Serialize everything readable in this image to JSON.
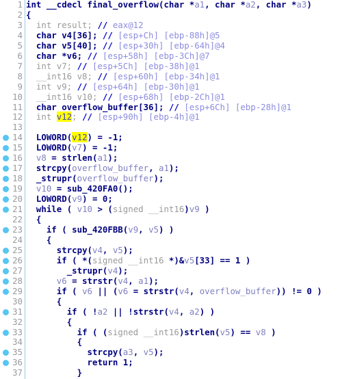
{
  "app": {
    "view": "pseudocode",
    "function_name": "final_overflow",
    "background": "#ffffff",
    "gutter_rule_color": "#9ec8e8",
    "marker_dot_color": "#56c6f2",
    "highlight_color": "#ffff00",
    "keyword_color": "#00007f",
    "comment_color": "#8c8ce0",
    "variable_color": "#8080c0",
    "linenumber_color": "#9a9a9a"
  },
  "highlighted_token": "v12",
  "lines": [
    {
      "n": "1",
      "dot": false,
      "indent": 0,
      "tokens": [
        {
          "t": "kw",
          "v": "int"
        },
        {
          "t": "plain",
          "v": " __cdecl "
        },
        {
          "t": "name",
          "v": "final_overflow"
        },
        {
          "t": "punc",
          "v": "("
        },
        {
          "t": "kw",
          "v": "char"
        },
        {
          "t": "plain",
          "v": " *"
        },
        {
          "t": "arg",
          "v": "a1"
        },
        {
          "t": "punc",
          "v": ", "
        },
        {
          "t": "kw",
          "v": "char"
        },
        {
          "t": "plain",
          "v": " *"
        },
        {
          "t": "arg",
          "v": "a2"
        },
        {
          "t": "punc",
          "v": ", "
        },
        {
          "t": "kw",
          "v": "char"
        },
        {
          "t": "plain",
          "v": " *"
        },
        {
          "t": "arg",
          "v": "a3"
        },
        {
          "t": "punc",
          "v": ")"
        }
      ]
    },
    {
      "n": "2",
      "dot": false,
      "indent": 0,
      "tokens": [
        {
          "t": "punc",
          "v": "{"
        }
      ]
    },
    {
      "n": "3",
      "dot": false,
      "indent": 1,
      "tokens": [
        {
          "t": "gray",
          "v": "int "
        },
        {
          "t": "gray",
          "v": "result"
        },
        {
          "t": "gray",
          "v": "; "
        },
        {
          "t": "cmt-slash",
          "v": "// "
        },
        {
          "t": "cmt",
          "v": "eax@12"
        }
      ]
    },
    {
      "n": "4",
      "dot": false,
      "indent": 1,
      "tokens": [
        {
          "t": "kw",
          "v": "char"
        },
        {
          "t": "plain",
          "v": " v4[36]; "
        },
        {
          "t": "cmt-slash",
          "v": "// "
        },
        {
          "t": "cmt",
          "v": "[esp+Ch] [ebp-88h]@5"
        }
      ]
    },
    {
      "n": "5",
      "dot": false,
      "indent": 1,
      "tokens": [
        {
          "t": "kw",
          "v": "char"
        },
        {
          "t": "plain",
          "v": " v5[40]; "
        },
        {
          "t": "cmt-slash",
          "v": "// "
        },
        {
          "t": "cmt",
          "v": "[esp+30h] [ebp-64h]@4"
        }
      ]
    },
    {
      "n": "6",
      "dot": false,
      "indent": 1,
      "tokens": [
        {
          "t": "kw",
          "v": "char"
        },
        {
          "t": "plain",
          "v": " *v6; "
        },
        {
          "t": "cmt-slash",
          "v": "// "
        },
        {
          "t": "cmt",
          "v": "[esp+58h] [ebp-3Ch]@7"
        }
      ]
    },
    {
      "n": "7",
      "dot": false,
      "indent": 1,
      "tokens": [
        {
          "t": "gray",
          "v": "int v7; "
        },
        {
          "t": "cmt-slash",
          "v": "// "
        },
        {
          "t": "cmt",
          "v": "[esp+5Ch] [ebp-38h]@1"
        }
      ]
    },
    {
      "n": "8",
      "dot": false,
      "indent": 1,
      "tokens": [
        {
          "t": "gray",
          "v": "__int16 v8; "
        },
        {
          "t": "cmt-slash",
          "v": "// "
        },
        {
          "t": "cmt",
          "v": "[esp+60h] [ebp-34h]@1"
        }
      ]
    },
    {
      "n": "9",
      "dot": false,
      "indent": 1,
      "tokens": [
        {
          "t": "gray",
          "v": "int v9; "
        },
        {
          "t": "cmt-slash",
          "v": "// "
        },
        {
          "t": "cmt",
          "v": "[esp+64h] [ebp-30h]@1"
        }
      ]
    },
    {
      "n": "10",
      "dot": false,
      "indent": 1,
      "tokens": [
        {
          "t": "gray",
          "v": "__int16 v10; "
        },
        {
          "t": "cmt-slash",
          "v": "// "
        },
        {
          "t": "cmt",
          "v": "[esp+68h] [ebp-2Ch]@1"
        }
      ]
    },
    {
      "n": "11",
      "dot": false,
      "indent": 1,
      "tokens": [
        {
          "t": "kw",
          "v": "char"
        },
        {
          "t": "plain",
          "v": " overflow_buffer[36]; "
        },
        {
          "t": "cmt-slash",
          "v": "// "
        },
        {
          "t": "cmt",
          "v": "[esp+6Ch] [ebp-28h]@1"
        }
      ]
    },
    {
      "n": "12",
      "dot": false,
      "indent": 1,
      "tokens": [
        {
          "t": "gray",
          "v": "int "
        },
        {
          "t": "hl",
          "v": "v12"
        },
        {
          "t": "gray",
          "v": "; "
        },
        {
          "t": "cmt-slash",
          "v": "// "
        },
        {
          "t": "cmt",
          "v": "[esp+90h] [ebp-4h]@1"
        }
      ]
    },
    {
      "n": "13",
      "dot": false,
      "indent": 0,
      "tokens": []
    },
    {
      "n": "14",
      "dot": true,
      "indent": 1,
      "tokens": [
        {
          "t": "fn",
          "v": "LOWORD"
        },
        {
          "t": "punc",
          "v": "("
        },
        {
          "t": "hl",
          "v": "v12"
        },
        {
          "t": "punc",
          "v": ") = -1;"
        }
      ]
    },
    {
      "n": "15",
      "dot": true,
      "indent": 1,
      "tokens": [
        {
          "t": "fn",
          "v": "LOWORD"
        },
        {
          "t": "punc",
          "v": "("
        },
        {
          "t": "var",
          "v": "v7"
        },
        {
          "t": "punc",
          "v": ") = -1;"
        }
      ]
    },
    {
      "n": "16",
      "dot": true,
      "indent": 1,
      "tokens": [
        {
          "t": "var",
          "v": "v8"
        },
        {
          "t": "punc",
          "v": " = "
        },
        {
          "t": "fn",
          "v": "strlen"
        },
        {
          "t": "punc",
          "v": "("
        },
        {
          "t": "arg",
          "v": "a1"
        },
        {
          "t": "punc",
          "v": ");"
        }
      ]
    },
    {
      "n": "17",
      "dot": true,
      "indent": 1,
      "tokens": [
        {
          "t": "fn",
          "v": "strcpy"
        },
        {
          "t": "punc",
          "v": "("
        },
        {
          "t": "var",
          "v": "overflow_buffer"
        },
        {
          "t": "punc",
          "v": ", "
        },
        {
          "t": "arg",
          "v": "a1"
        },
        {
          "t": "punc",
          "v": ");"
        }
      ]
    },
    {
      "n": "18",
      "dot": true,
      "indent": 1,
      "tokens": [
        {
          "t": "fn",
          "v": "_strupr"
        },
        {
          "t": "punc",
          "v": "("
        },
        {
          "t": "var",
          "v": "overflow_buffer"
        },
        {
          "t": "punc",
          "v": ");"
        }
      ]
    },
    {
      "n": "19",
      "dot": true,
      "indent": 1,
      "tokens": [
        {
          "t": "var",
          "v": "v10"
        },
        {
          "t": "punc",
          "v": " = "
        },
        {
          "t": "fn",
          "v": "sub_420FA0"
        },
        {
          "t": "punc",
          "v": "();"
        }
      ]
    },
    {
      "n": "20",
      "dot": true,
      "indent": 1,
      "tokens": [
        {
          "t": "fn",
          "v": "LOWORD"
        },
        {
          "t": "punc",
          "v": "("
        },
        {
          "t": "var",
          "v": "v9"
        },
        {
          "t": "punc",
          "v": ") = 0;"
        }
      ]
    },
    {
      "n": "21",
      "dot": true,
      "indent": 1,
      "tokens": [
        {
          "t": "kw",
          "v": "while"
        },
        {
          "t": "punc",
          "v": " ( "
        },
        {
          "t": "var",
          "v": "v10"
        },
        {
          "t": "punc",
          "v": " > ("
        },
        {
          "t": "gray",
          "v": "signed __int16"
        },
        {
          "t": "punc",
          "v": ")"
        },
        {
          "t": "var",
          "v": "v9"
        },
        {
          "t": "punc",
          "v": " )"
        }
      ]
    },
    {
      "n": "22",
      "dot": false,
      "indent": 1,
      "tokens": [
        {
          "t": "punc",
          "v": "{"
        }
      ]
    },
    {
      "n": "23",
      "dot": true,
      "indent": 2,
      "tokens": [
        {
          "t": "kw",
          "v": "if"
        },
        {
          "t": "punc",
          "v": " ( "
        },
        {
          "t": "fn",
          "v": "sub_420FBB"
        },
        {
          "t": "punc",
          "v": "("
        },
        {
          "t": "var",
          "v": "v9"
        },
        {
          "t": "punc",
          "v": ", "
        },
        {
          "t": "var",
          "v": "v5"
        },
        {
          "t": "punc",
          "v": ") )"
        }
      ]
    },
    {
      "n": "24",
      "dot": false,
      "indent": 2,
      "tokens": [
        {
          "t": "punc",
          "v": "{"
        }
      ]
    },
    {
      "n": "25",
      "dot": true,
      "indent": 3,
      "tokens": [
        {
          "t": "fn",
          "v": "strcpy"
        },
        {
          "t": "punc",
          "v": "("
        },
        {
          "t": "var",
          "v": "v4"
        },
        {
          "t": "punc",
          "v": ", "
        },
        {
          "t": "var",
          "v": "v5"
        },
        {
          "t": "punc",
          "v": ");"
        }
      ]
    },
    {
      "n": "26",
      "dot": true,
      "indent": 3,
      "tokens": [
        {
          "t": "kw",
          "v": "if"
        },
        {
          "t": "punc",
          "v": " ( *("
        },
        {
          "t": "gray",
          "v": "signed __int16 "
        },
        {
          "t": "punc",
          "v": "*)&"
        },
        {
          "t": "var",
          "v": "v5"
        },
        {
          "t": "punc",
          "v": "[33] == 1 )"
        }
      ]
    },
    {
      "n": "27",
      "dot": true,
      "indent": 4,
      "tokens": [
        {
          "t": "fn",
          "v": "_strupr"
        },
        {
          "t": "punc",
          "v": "("
        },
        {
          "t": "var",
          "v": "v4"
        },
        {
          "t": "punc",
          "v": ");"
        }
      ]
    },
    {
      "n": "28",
      "dot": true,
      "indent": 3,
      "tokens": [
        {
          "t": "var",
          "v": "v6"
        },
        {
          "t": "punc",
          "v": " = "
        },
        {
          "t": "fn",
          "v": "strstr"
        },
        {
          "t": "punc",
          "v": "("
        },
        {
          "t": "var",
          "v": "v4"
        },
        {
          "t": "punc",
          "v": ", "
        },
        {
          "t": "arg",
          "v": "a1"
        },
        {
          "t": "punc",
          "v": ");"
        }
      ]
    },
    {
      "n": "29",
      "dot": true,
      "indent": 3,
      "tokens": [
        {
          "t": "kw",
          "v": "if"
        },
        {
          "t": "punc",
          "v": " ( "
        },
        {
          "t": "var",
          "v": "v6"
        },
        {
          "t": "punc",
          "v": " || ("
        },
        {
          "t": "var",
          "v": "v6"
        },
        {
          "t": "punc",
          "v": " = "
        },
        {
          "t": "fn",
          "v": "strstr"
        },
        {
          "t": "punc",
          "v": "("
        },
        {
          "t": "var",
          "v": "v4"
        },
        {
          "t": "punc",
          "v": ", "
        },
        {
          "t": "var",
          "v": "overflow_buffer"
        },
        {
          "t": "punc",
          "v": ")) != 0 )"
        }
      ]
    },
    {
      "n": "30",
      "dot": false,
      "indent": 3,
      "tokens": [
        {
          "t": "punc",
          "v": "{"
        }
      ]
    },
    {
      "n": "31",
      "dot": true,
      "indent": 4,
      "tokens": [
        {
          "t": "kw",
          "v": "if"
        },
        {
          "t": "punc",
          "v": " ( !"
        },
        {
          "t": "arg",
          "v": "a2"
        },
        {
          "t": "punc",
          "v": " || !"
        },
        {
          "t": "fn",
          "v": "strstr"
        },
        {
          "t": "punc",
          "v": "("
        },
        {
          "t": "var",
          "v": "v4"
        },
        {
          "t": "punc",
          "v": ", "
        },
        {
          "t": "arg",
          "v": "a2"
        },
        {
          "t": "punc",
          "v": ") )"
        }
      ]
    },
    {
      "n": "32",
      "dot": false,
      "indent": 4,
      "tokens": [
        {
          "t": "punc",
          "v": "{"
        }
      ]
    },
    {
      "n": "33",
      "dot": true,
      "indent": 5,
      "tokens": [
        {
          "t": "kw",
          "v": "if"
        },
        {
          "t": "punc",
          "v": " ( ("
        },
        {
          "t": "gray",
          "v": "signed __int16"
        },
        {
          "t": "punc",
          "v": ")"
        },
        {
          "t": "fn",
          "v": "strlen"
        },
        {
          "t": "punc",
          "v": "("
        },
        {
          "t": "var",
          "v": "v5"
        },
        {
          "t": "punc",
          "v": ") == "
        },
        {
          "t": "var",
          "v": "v8"
        },
        {
          "t": "punc",
          "v": " )"
        }
      ]
    },
    {
      "n": "34",
      "dot": false,
      "indent": 5,
      "tokens": [
        {
          "t": "punc",
          "v": "{"
        }
      ]
    },
    {
      "n": "35",
      "dot": true,
      "indent": 6,
      "tokens": [
        {
          "t": "fn",
          "v": "strcpy"
        },
        {
          "t": "punc",
          "v": "("
        },
        {
          "t": "arg",
          "v": "a3"
        },
        {
          "t": "punc",
          "v": ", "
        },
        {
          "t": "var",
          "v": "v5"
        },
        {
          "t": "punc",
          "v": ");"
        }
      ]
    },
    {
      "n": "36",
      "dot": true,
      "indent": 6,
      "tokens": [
        {
          "t": "kw",
          "v": "return"
        },
        {
          "t": "punc",
          "v": " 1;"
        }
      ]
    },
    {
      "n": "37",
      "dot": false,
      "indent": 5,
      "tokens": [
        {
          "t": "punc",
          "v": "}"
        }
      ]
    }
  ]
}
